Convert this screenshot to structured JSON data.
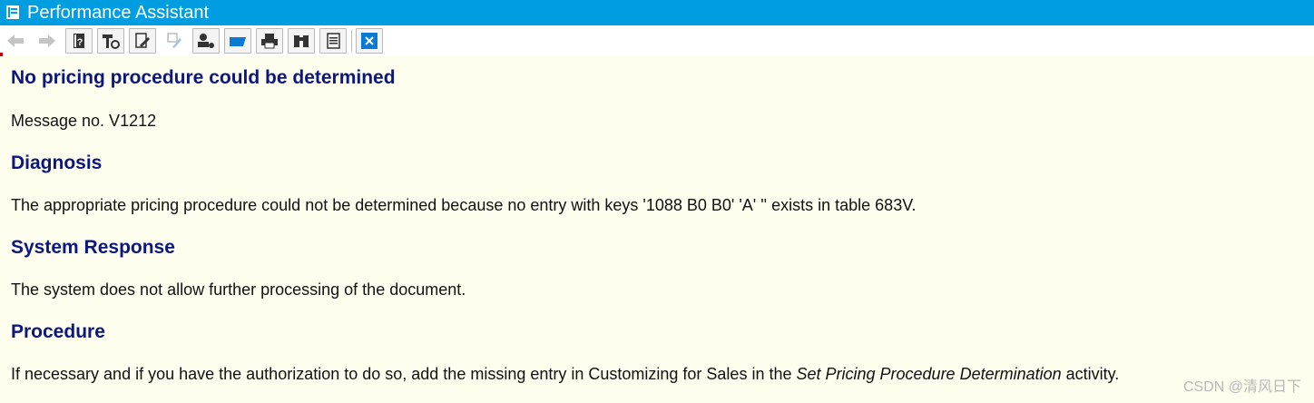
{
  "window": {
    "title": "Performance Assistant"
  },
  "toolbar": {
    "buttons": [
      {
        "name": "back-button",
        "icon": "arrow-left-icon",
        "enabled": false
      },
      {
        "name": "forward-button",
        "icon": "arrow-right-icon",
        "enabled": false
      },
      {
        "name": "help-button",
        "icon": "help-book-icon",
        "enabled": true
      },
      {
        "name": "technical-info-button",
        "icon": "tools-icon",
        "enabled": true
      },
      {
        "name": "edit-button",
        "icon": "pencil-doc-icon",
        "enabled": true
      },
      {
        "name": "highlight-button",
        "icon": "marker-icon",
        "enabled": false
      },
      {
        "name": "user-settings-button",
        "icon": "user-key-icon",
        "enabled": true
      },
      {
        "name": "bookmark-button",
        "icon": "bookmark-icon",
        "enabled": true
      },
      {
        "name": "print-button",
        "icon": "printer-icon",
        "enabled": true
      },
      {
        "name": "find-button",
        "icon": "binoculars-icon",
        "enabled": true
      },
      {
        "name": "document-button",
        "icon": "document-icon",
        "enabled": true
      },
      {
        "name": "close-button",
        "icon": "close-icon",
        "enabled": true
      }
    ]
  },
  "message": {
    "title": "No pricing procedure could be determined",
    "number_line": "Message no. V1212",
    "sections": [
      {
        "heading": "Diagnosis",
        "text": "The appropriate pricing procedure could not be determined because no entry with keys '1088 B0 B0' 'A' '' exists in table 683V."
      },
      {
        "heading": "System Response",
        "text": "The system does not allow further processing of the document."
      },
      {
        "heading": "Procedure",
        "text_before": "If necessary and if you have the authorization to do so, add the missing entry in Customizing for Sales in the ",
        "text_link": "Set Pricing Procedure Determination",
        "text_after": " activity."
      }
    ]
  },
  "watermark": "CSDN @清风日下"
}
